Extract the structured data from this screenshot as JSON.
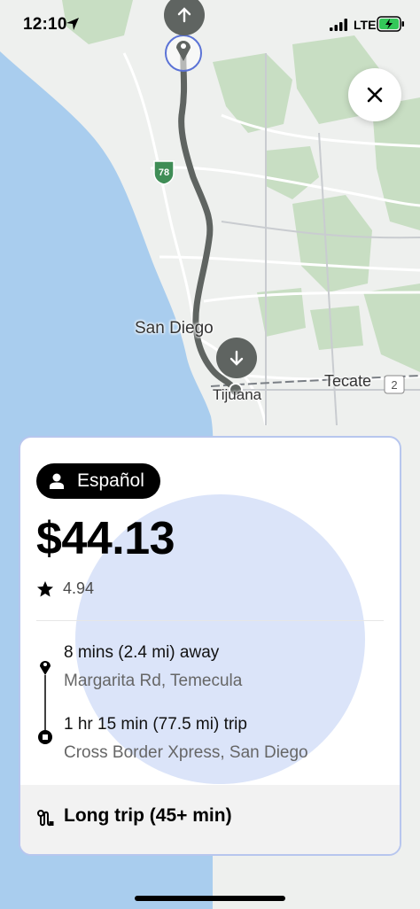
{
  "status_bar": {
    "time": "12:10",
    "network": "LTE"
  },
  "map": {
    "labels": {
      "san_diego": "San Diego",
      "tijuana": "Tijuana",
      "tecate": "Tecate"
    },
    "route_shields": {
      "route_78": "78",
      "route_2": "2"
    }
  },
  "card": {
    "language": "Español",
    "price": "$44.13",
    "rating": "4.94",
    "pickup": {
      "eta": "8 mins (2.4 mi) away",
      "location": "Margarita Rd, Temecula"
    },
    "dropoff": {
      "trip": "1 hr 15 min (77.5 mi) trip",
      "location": "Cross Border Xpress, San Diego"
    },
    "footer_label": "Long trip (45+ min)"
  },
  "colors": {
    "ocean": "#a9cdee",
    "land": "#eef0ee",
    "park": "#c8dec3",
    "route": "#5f6461",
    "card_border": "#b7c6ee",
    "highlight": "#dbe4f9"
  }
}
